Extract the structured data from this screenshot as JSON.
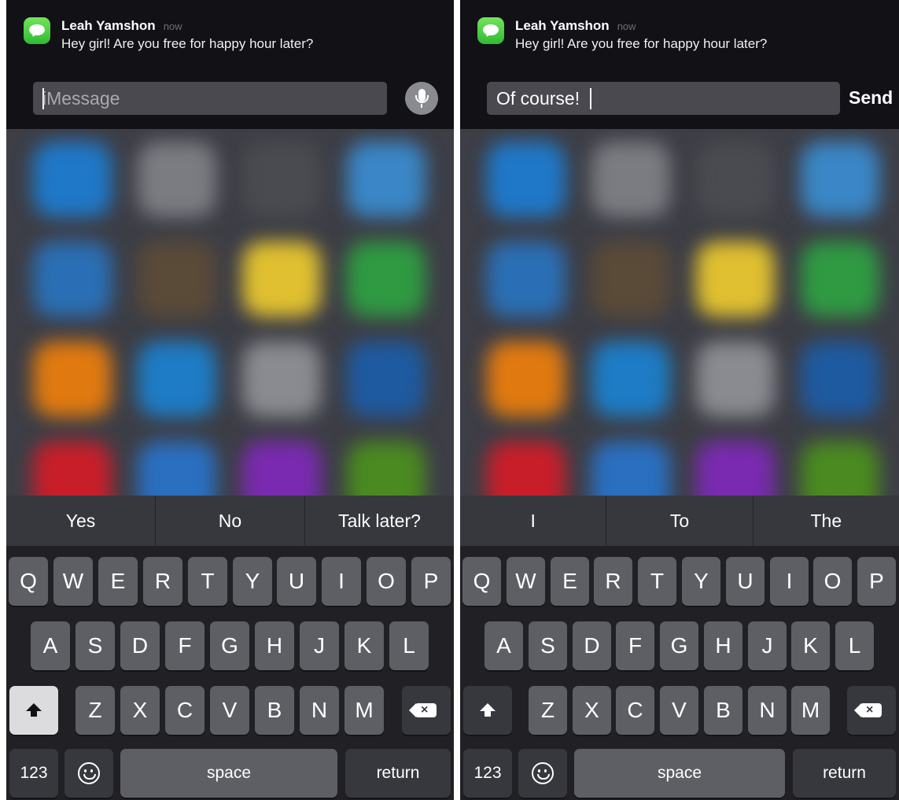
{
  "panels": [
    {
      "notification": {
        "app_icon": "messages-icon",
        "sender": "Leah Yamshon",
        "time": "now",
        "message": "Hey girl! Are you free for happy hour later?"
      },
      "reply": {
        "value": "",
        "placeholder": "iMessage",
        "action_icon": "microphone-icon"
      },
      "predictions": [
        "Yes",
        "No",
        "Talk later?"
      ]
    },
    {
      "notification": {
        "app_icon": "messages-icon",
        "sender": "Leah Yamshon",
        "time": "now",
        "message": "Hey girl! Are you free for happy hour later?"
      },
      "reply": {
        "value": "Of course!",
        "placeholder": "iMessage",
        "action_label": "Send"
      },
      "predictions": [
        "I",
        "To",
        "The"
      ]
    }
  ],
  "keyboard": {
    "row1": [
      "Q",
      "W",
      "E",
      "R",
      "T",
      "Y",
      "U",
      "I",
      "O",
      "P"
    ],
    "row2": [
      "A",
      "S",
      "D",
      "F",
      "G",
      "H",
      "J",
      "K",
      "L"
    ],
    "row3": [
      "Z",
      "X",
      "C",
      "V",
      "B",
      "N",
      "M"
    ],
    "numbers_label": "123",
    "space_label": "space",
    "return_label": "return",
    "icons": [
      "shift-icon",
      "delete-icon",
      "emoji-icon"
    ]
  },
  "colors": {
    "messages_green": "#4cd964",
    "banner_bg": "#0e0e12",
    "key_bg": "#5e5f65",
    "keyboard_bg": "#212125"
  }
}
